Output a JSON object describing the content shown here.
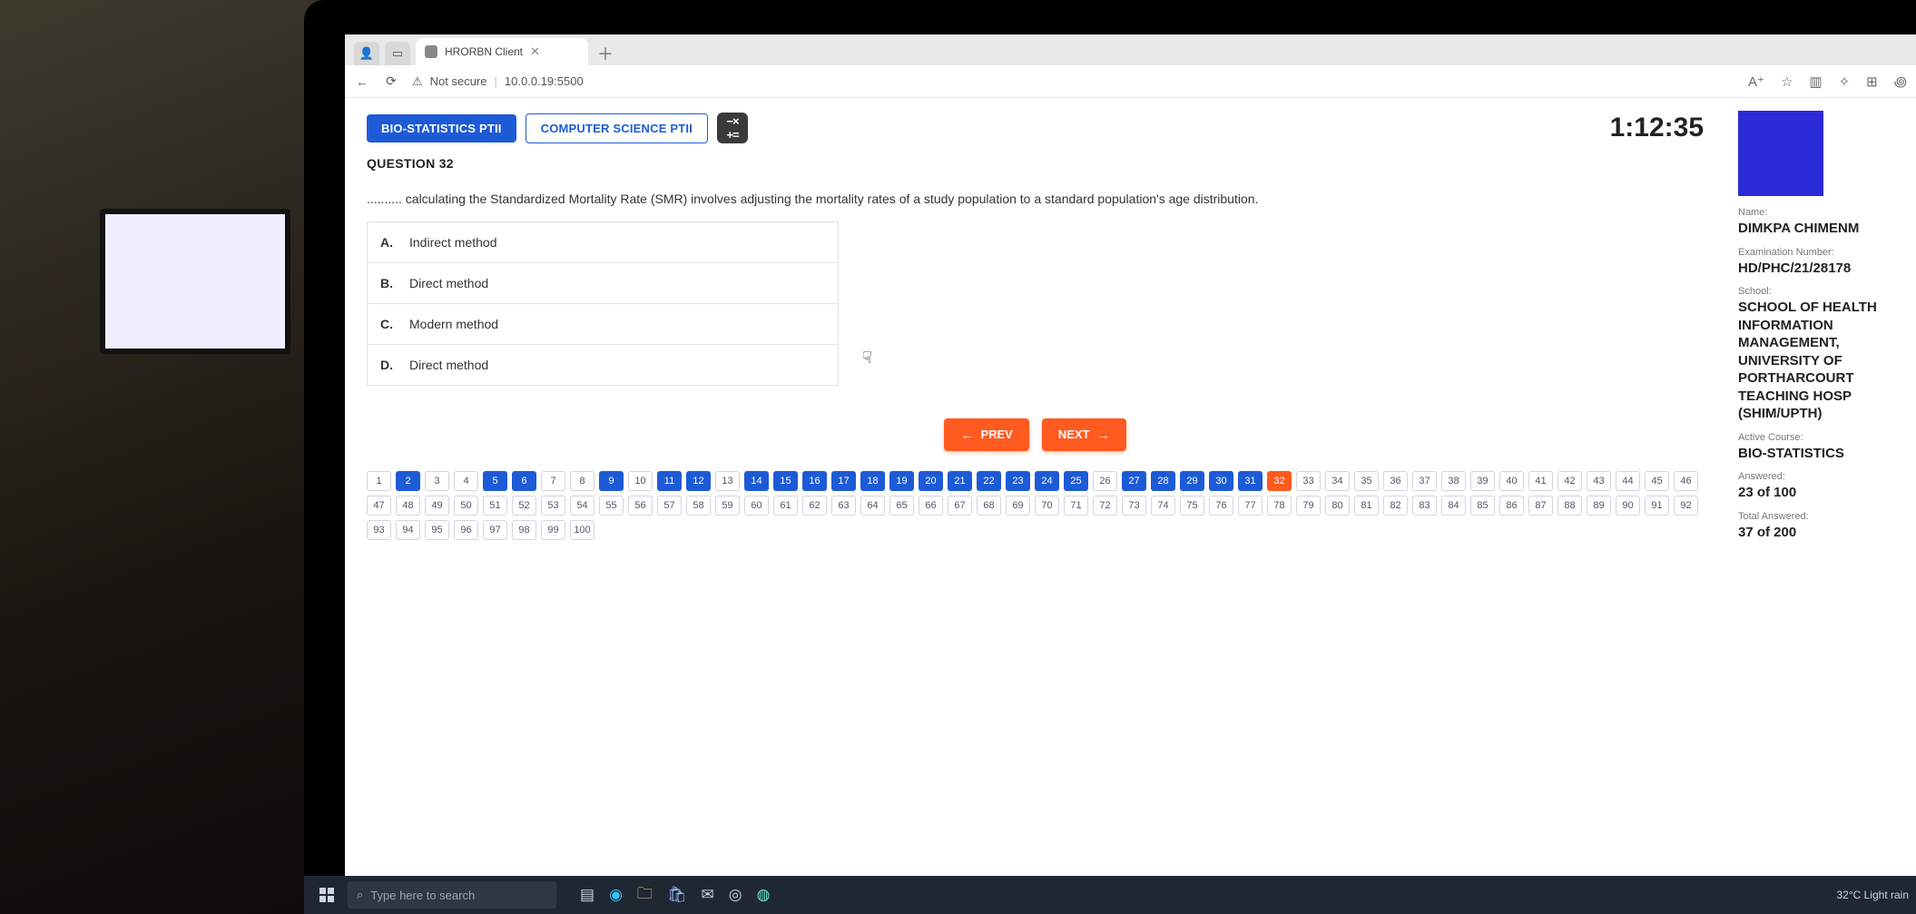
{
  "browser": {
    "tab_title": "HRORBN Client",
    "not_secure": "Not secure",
    "address": "10.0.0.19:5500"
  },
  "timer": "1:12:35",
  "tabs": {
    "active": "BIO-STATISTICS PTII",
    "inactive": "COMPUTER SCIENCE PTII"
  },
  "question": {
    "heading": "QUESTION 32",
    "text": ".......... calculating the Standardized Mortality Rate (SMR) involves adjusting the mortality rates of a study population to a standard population's age distribution.",
    "options": [
      {
        "label": "A.",
        "text": "Indirect method"
      },
      {
        "label": "B.",
        "text": "Direct method"
      },
      {
        "label": "C.",
        "text": "Modern method"
      },
      {
        "label": "D.",
        "text": "Direct method"
      }
    ]
  },
  "nav": {
    "prev": "PREV",
    "next": "NEXT"
  },
  "pager": {
    "total": 100,
    "current": 32,
    "answered": [
      2,
      5,
      6,
      9,
      11,
      12,
      14,
      15,
      16,
      17,
      18,
      19,
      20,
      21,
      22,
      23,
      24,
      25,
      27,
      28,
      29,
      30,
      31
    ]
  },
  "side": {
    "name_label": "Name:",
    "name": "DIMKPA CHIMENM",
    "exam_no_label": "Examination Number:",
    "exam_no": "HD/PHC/21/28178",
    "school_label": "School:",
    "school": "SCHOOL OF HEALTH INFORMATION MANAGEMENT, UNIVERSITY OF PORTHARCOURT TEACHING HOSP (SHIM/UPTH)",
    "course_label": "Active Course:",
    "course": "BIO-STATISTICS",
    "answered_label": "Answered:",
    "answered": "23 of 100",
    "total_label": "Total Answered:",
    "total": "37 of 200"
  },
  "taskbar": {
    "search_placeholder": "Type here to search",
    "weather": "32°C  Light rain"
  }
}
